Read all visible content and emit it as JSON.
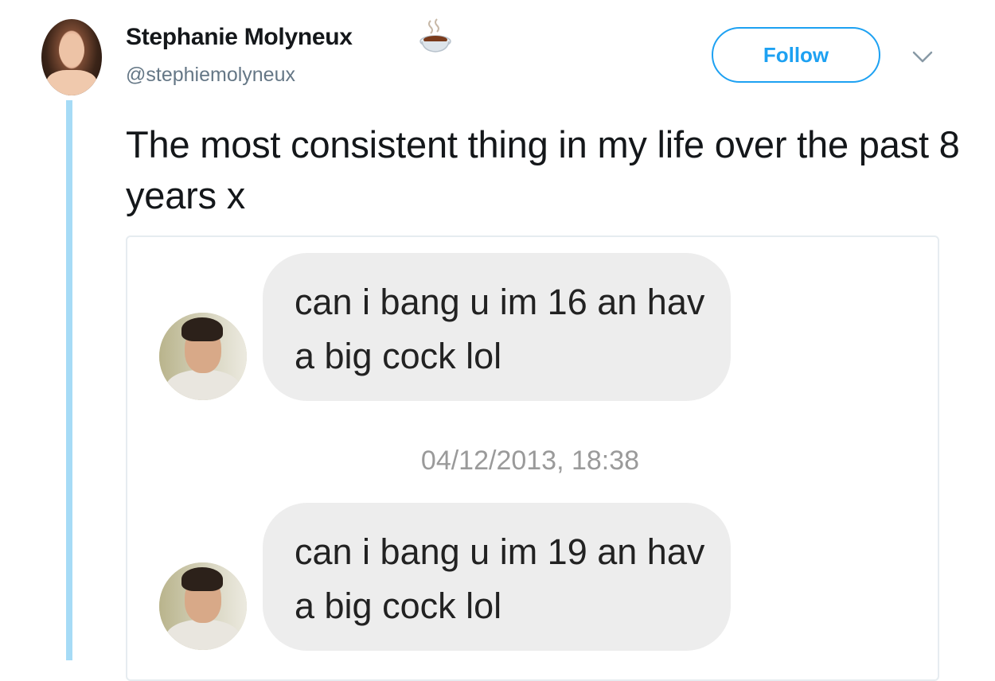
{
  "author": {
    "name": "Stephanie Molyneux",
    "handle": "@stephiemolyneux",
    "badge_icon": "hot-beverage-icon"
  },
  "actions": {
    "follow_label": "Follow",
    "menu_icon": "chevron-down-icon"
  },
  "tweet": {
    "text": "The most consistent thing in my life over the past 8 years x"
  },
  "screenshot": {
    "messages": [
      {
        "text": "can i bang u im 16 an hav a big cock lol"
      },
      {
        "text": "can i bang u im 19 an hav a big cock lol"
      }
    ],
    "timestamp": "04/12/2013, 18:38"
  },
  "colors": {
    "accent": "#1da1f2",
    "thread_line": "#a6dbf6",
    "bubble": "#ededed",
    "handle_text": "#657786"
  }
}
